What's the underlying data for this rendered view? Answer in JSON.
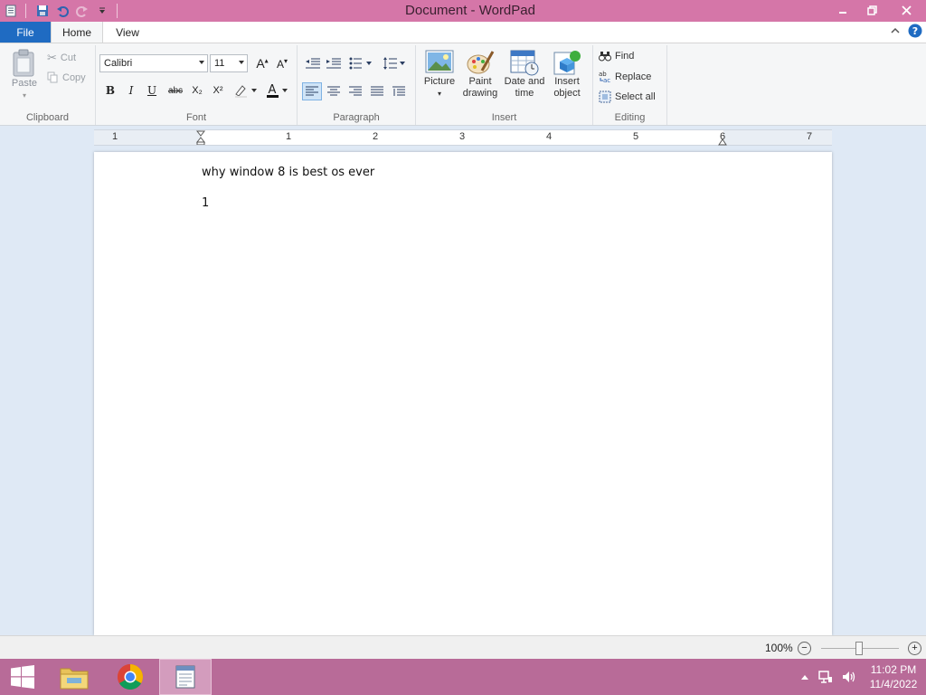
{
  "window": {
    "title": "Document - WordPad"
  },
  "tabs": {
    "file": "File",
    "home": "Home",
    "view": "View"
  },
  "ribbon": {
    "clipboard": {
      "label": "Clipboard",
      "paste": "Paste",
      "cut": "Cut",
      "copy": "Copy"
    },
    "font": {
      "label": "Font",
      "family": "Calibri",
      "size": "11",
      "bold": "B",
      "italic": "I",
      "underline": "U",
      "strike": "abc",
      "subscript": "X₂",
      "superscript": "X²"
    },
    "paragraph": {
      "label": "Paragraph"
    },
    "insert": {
      "label": "Insert",
      "picture": "Picture",
      "paint_line1": "Paint",
      "paint_line2": "drawing",
      "datetime_line1": "Date and",
      "datetime_line2": "time",
      "object_line1": "Insert",
      "object_line2": "object"
    },
    "editing": {
      "label": "Editing",
      "find": "Find",
      "replace": "Replace",
      "select_all": "Select all"
    }
  },
  "ruler": {
    "numbers": [
      "1",
      "1",
      "2",
      "3",
      "4",
      "5",
      "6",
      "7"
    ]
  },
  "document": {
    "lines": [
      "why window 8 is best os ever",
      "1"
    ]
  },
  "status": {
    "zoom": "100%",
    "zoom_out": "−",
    "zoom_in": "+",
    "zoom_level": 0.5
  },
  "taskbar": {
    "time": "11:02 PM",
    "date": "11/4/2022"
  },
  "colors": {
    "titlebar": "#d576a8",
    "file_tab": "#1f6bc2",
    "taskbar": "#b86b98"
  }
}
